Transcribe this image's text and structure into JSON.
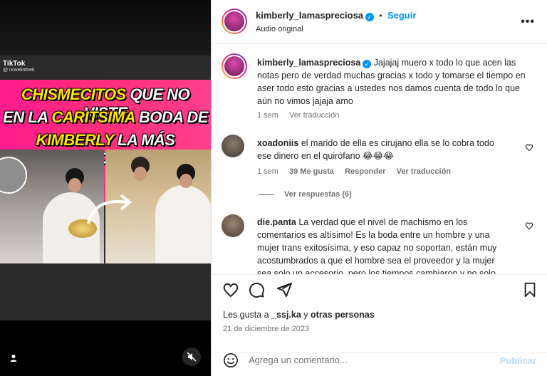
{
  "media": {
    "tiktok_label": "TikTok",
    "tiktok_handle": "@ novelinfoek",
    "banner": {
      "line1_a": "CHISMECITOS",
      "line1_b": " QUE NO VISTE",
      "line2_a": "EN LA ",
      "line2_b": "CARITSIMA",
      "line2_c": " BODA DE",
      "line3_a": "KIMBERLY",
      "line3_b": " LA MÁS PRECIOSA"
    },
    "colors": {
      "banner": "#ff2f7a",
      "highlight": "#ffe600"
    }
  },
  "header": {
    "username": "kimberly_lamaspreciosa",
    "follow_label": "Seguir",
    "dot": "•",
    "subtitle": "Audio original",
    "more_label": "•••"
  },
  "caption": {
    "username": "kimberly_lamaspreciosa",
    "text": "Jajajaj muero x todo lo que acen las notas pero de verdad muchas gracias x todo y tomarse el tiempo en aser todo esto gracias a ustedes nos damos cuenta de todo lo que aún no vimos jajaja amo",
    "time": "1 sem",
    "translate": "Ver traducción"
  },
  "comments": [
    {
      "username": "xoadoniis",
      "text": "el marido de ella es cirujano ella se lo cobra todo ese dinero en el quirófano 😂😂😂",
      "time": "1 sem",
      "likes": "39 Me gusta",
      "reply": "Responder",
      "translate": "Ver traducción",
      "view_replies": "Ver respuestas (6)"
    },
    {
      "username": "die.panta",
      "text": "La verdad que el nivel de machismo en los comentarios es altísimo! Es la boda entre un hombre y una mujer trans exitosísima, y eso capaz no soportan, están muy acostumbrados a que el hombre sea el proveedor y la mujer sea solo un accesorio, pero los tiempos cambiaron y no solo"
    }
  ],
  "post": {
    "likes_prefix": "Les gusta a ",
    "likes_user": "_ssj.ka",
    "likes_mid": " y ",
    "likes_others": "otras personas",
    "date": "21 de diciembre de 2023"
  },
  "composer": {
    "placeholder": "Agrega un comentario...",
    "publish_label": "Publicar"
  },
  "colors": {
    "accent": "#0095f6",
    "text": "#262626",
    "muted": "#737373"
  }
}
